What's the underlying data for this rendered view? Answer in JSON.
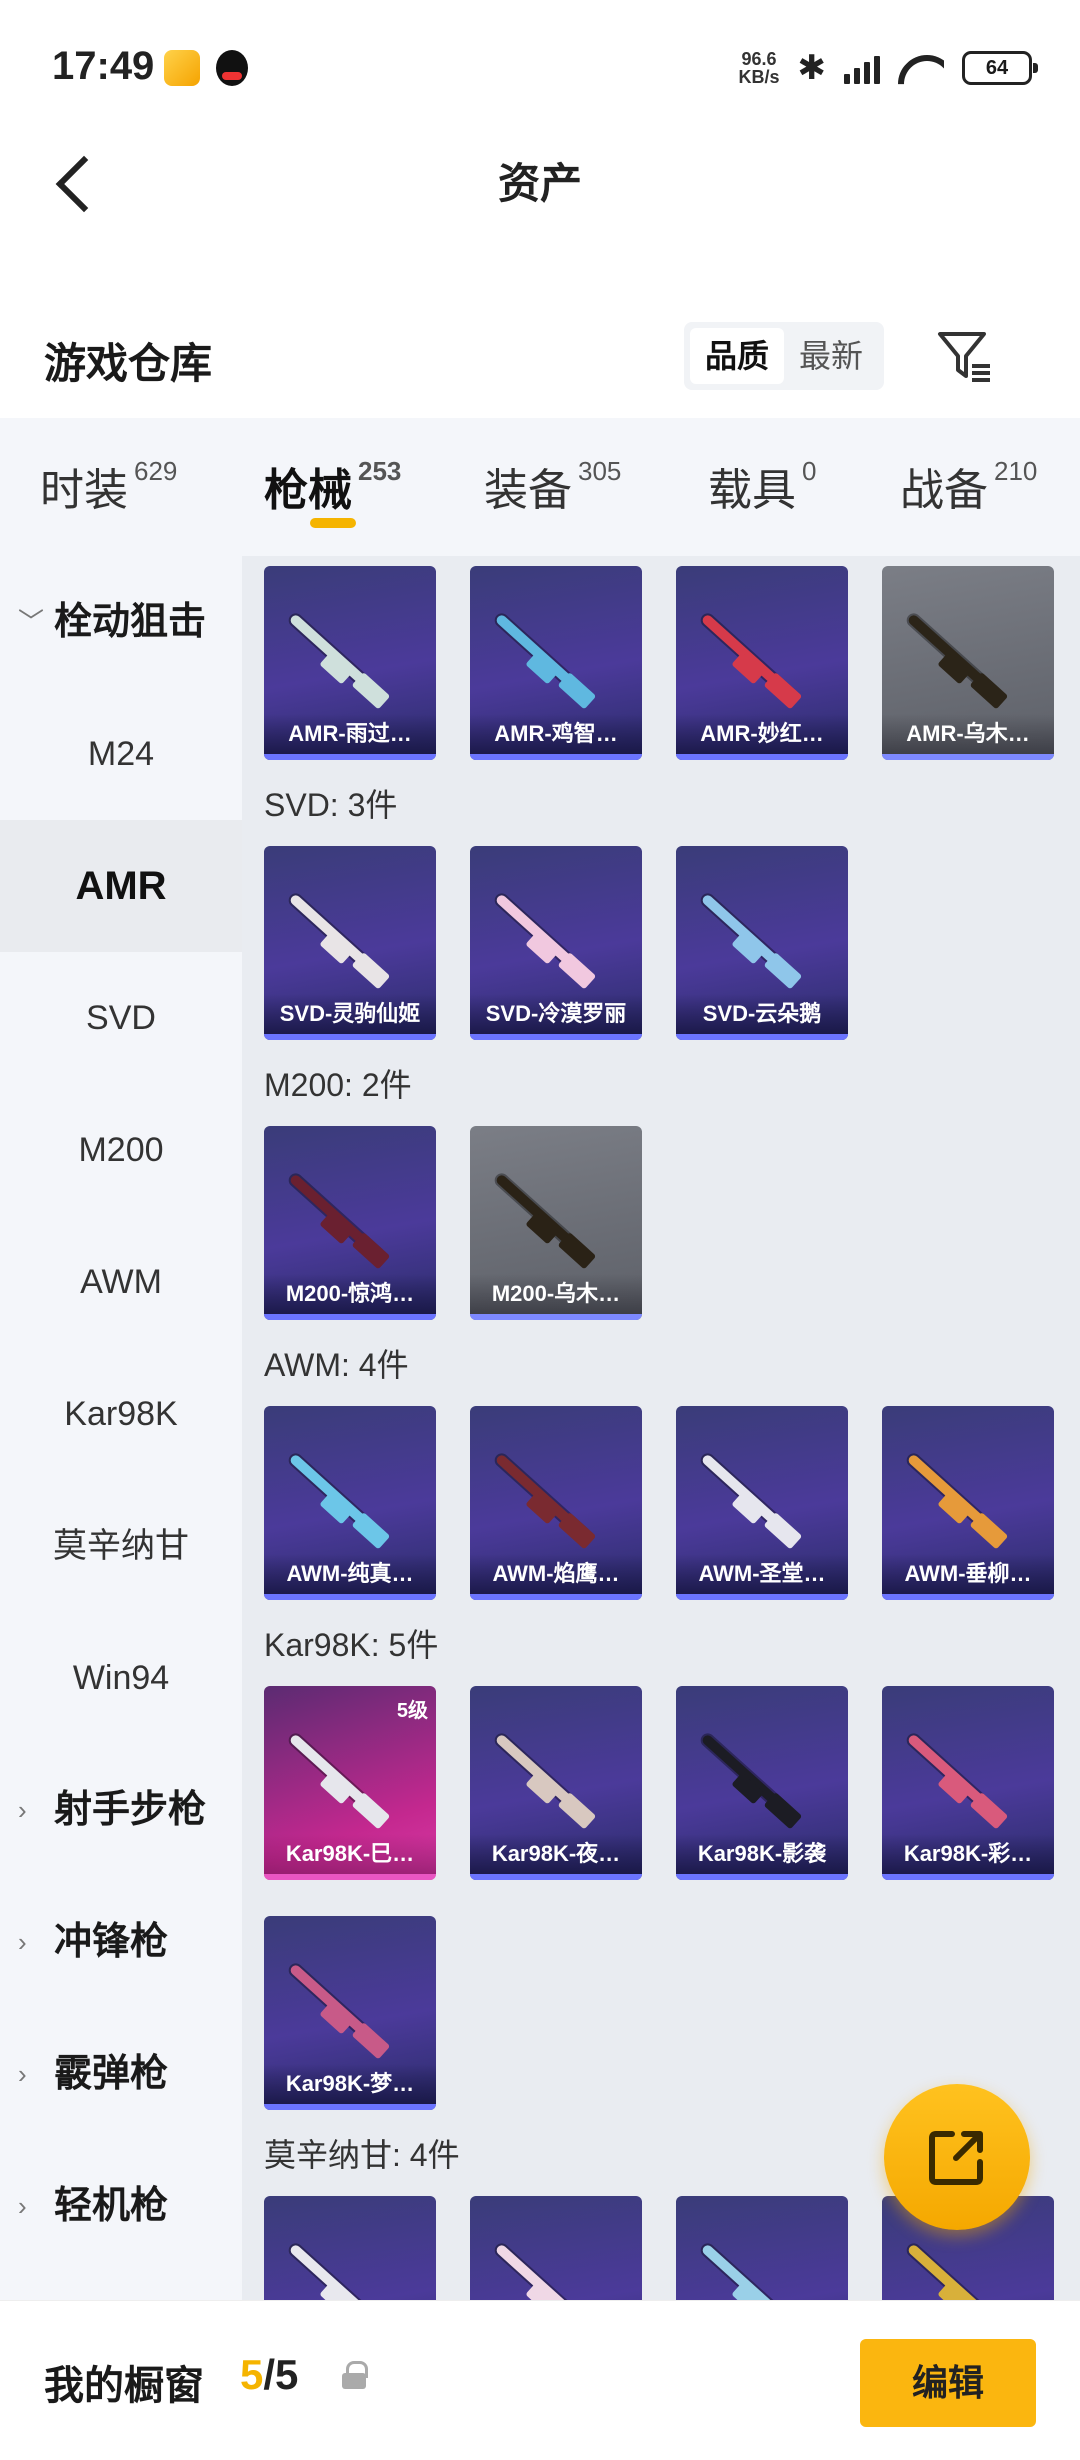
{
  "status": {
    "time": "17:49",
    "net_speed_value": "96.6",
    "net_speed_unit": "KB/s",
    "battery": "64"
  },
  "header": {
    "title": "资产"
  },
  "warehouse": {
    "title": "游戏仓库",
    "sort_quality": "品质",
    "sort_newest": "最新"
  },
  "tabs": [
    {
      "label": "时装",
      "count": "629"
    },
    {
      "label": "枪械",
      "count": "253"
    },
    {
      "label": "装备",
      "count": "305"
    },
    {
      "label": "载具",
      "count": "0"
    },
    {
      "label": "战备",
      "count": "210"
    }
  ],
  "sidebar": {
    "items": [
      {
        "label": "栓动狙击",
        "group": true,
        "expanded": true
      },
      {
        "label": "M24"
      },
      {
        "label": "AMR",
        "active": true
      },
      {
        "label": "SVD"
      },
      {
        "label": "M200"
      },
      {
        "label": "AWM"
      },
      {
        "label": "Kar98K"
      },
      {
        "label": "莫辛纳甘"
      },
      {
        "label": "Win94"
      },
      {
        "label": "射手步枪",
        "group": true
      },
      {
        "label": "冲锋枪",
        "group": true
      },
      {
        "label": "霰弹枪",
        "group": true
      },
      {
        "label": "轻机枪",
        "group": true
      }
    ]
  },
  "sections": {
    "svd": "SVD: 3件",
    "m200": "M200: 2件",
    "awm": "AWM: 4件",
    "kar98k": "Kar98K: 5件",
    "mosin": "莫辛纳甘: 4件"
  },
  "cards": {
    "amr": [
      "AMR-雨过…",
      "AMR-鸡智…",
      "AMR-妙红…",
      "AMR-乌木…"
    ],
    "svd": [
      "SVD-灵驹仙姬",
      "SVD-冷漠罗丽",
      "SVD-云朵鹅"
    ],
    "m200": [
      "M200-惊鸿…",
      "M200-乌木…"
    ],
    "awm": [
      "AWM-纯真…",
      "AWM-焰鹰…",
      "AWM-圣堂…",
      "AWM-垂柳…"
    ],
    "kar98k": [
      "Kar98K-巳…",
      "Kar98K-夜…",
      "Kar98K-影袭",
      "Kar98K-彩…",
      "Kar98K-梦…"
    ],
    "kar98k_level": "5级"
  },
  "bottom": {
    "label": "我的橱窗",
    "count_current": "5",
    "count_total": "/5",
    "edit_label": "编辑"
  },
  "colors": {
    "accent": "#F5B400",
    "card_purple": "#4B3A9A",
    "card_gray": "#6B6E76",
    "card_pink": "#C4288F"
  }
}
